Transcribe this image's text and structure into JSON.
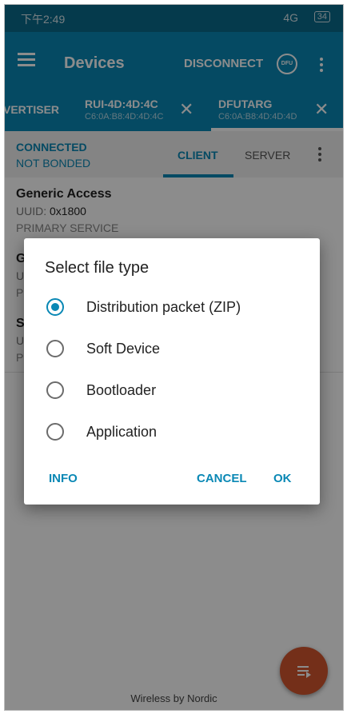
{
  "status_bar": {
    "time": "下午2:49",
    "signal": "4G",
    "battery": "34"
  },
  "app_bar": {
    "title": "Devices",
    "disconnect_label": "DISCONNECT",
    "dfu_icon_label": "DFU"
  },
  "device_tabs": [
    {
      "name": "VERTISER",
      "address": ""
    },
    {
      "name": "RUI-4D:4D:4C",
      "address": "C6:0A:B8:4D:4D:4C"
    },
    {
      "name": "DFUTARG",
      "address": "C6:0A:B8:4D:4D:4D"
    }
  ],
  "connection": {
    "state": "CONNECTED",
    "bond": "NOT BONDED"
  },
  "subtabs": {
    "client": "CLIENT",
    "server": "SERVER"
  },
  "services": [
    {
      "name": "Generic Access",
      "uuid_label": "UUID:",
      "uuid": "0x1800",
      "type": "PRIMARY SERVICE"
    },
    {
      "name": "G",
      "uuid_label": "U",
      "uuid": "",
      "type": "P"
    },
    {
      "name": "S",
      "uuid_label": "U",
      "uuid": "",
      "type": "P"
    }
  ],
  "dialog": {
    "title": "Select file type",
    "options": [
      {
        "label": "Distribution packet (ZIP)",
        "selected": true
      },
      {
        "label": "Soft Device",
        "selected": false
      },
      {
        "label": "Bootloader",
        "selected": false
      },
      {
        "label": "Application",
        "selected": false
      }
    ],
    "info_label": "INFO",
    "cancel_label": "CANCEL",
    "ok_label": "OK"
  },
  "footer": "Wireless by Nordic",
  "colors": {
    "primary": "#0a88b5",
    "status_bar": "#0a6a8a",
    "fab": "#d4562f"
  }
}
